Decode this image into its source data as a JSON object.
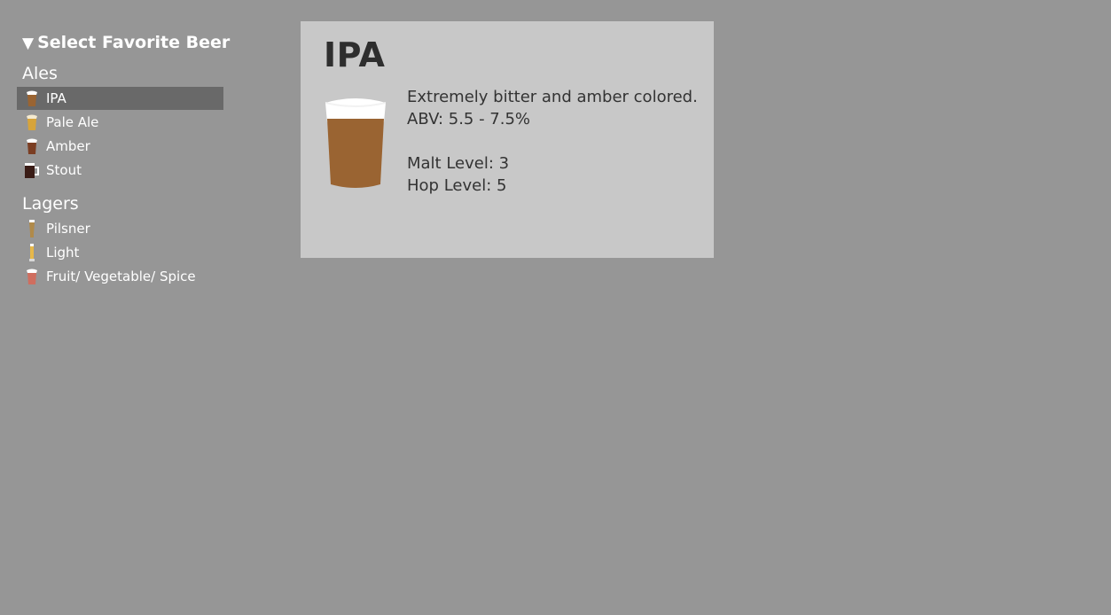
{
  "sidebar": {
    "header": "Select Favorite Beer",
    "groups": [
      {
        "label": "Ales",
        "items": [
          {
            "label": "IPA",
            "color": "#9a6432",
            "selected": true
          },
          {
            "label": "Pale Ale",
            "color": "#d7a43a"
          },
          {
            "label": "Amber",
            "color": "#7b3e23"
          },
          {
            "label": "Stout",
            "color": "#3a1c16"
          }
        ]
      },
      {
        "label": "Lagers",
        "items": [
          {
            "label": "Pilsner",
            "color": "#b08a4a"
          },
          {
            "label": "Light",
            "color": "#e7b84a"
          },
          {
            "label": "Fruit/ Vegetable/ Spice",
            "color": "#cf6e5f"
          }
        ]
      }
    ]
  },
  "detail": {
    "title": "IPA",
    "description": "Extremely bitter and amber colored.",
    "abv": "ABV: 5.5 - 7.5%",
    "malt": "Malt Level: 3",
    "hop": "Hop Level: 5",
    "beer_color": "#9a6432",
    "foam_color": "#ffffff"
  },
  "colors": {
    "background": "#969696",
    "card": "#c8c8c8",
    "selected_row": "#696969"
  }
}
